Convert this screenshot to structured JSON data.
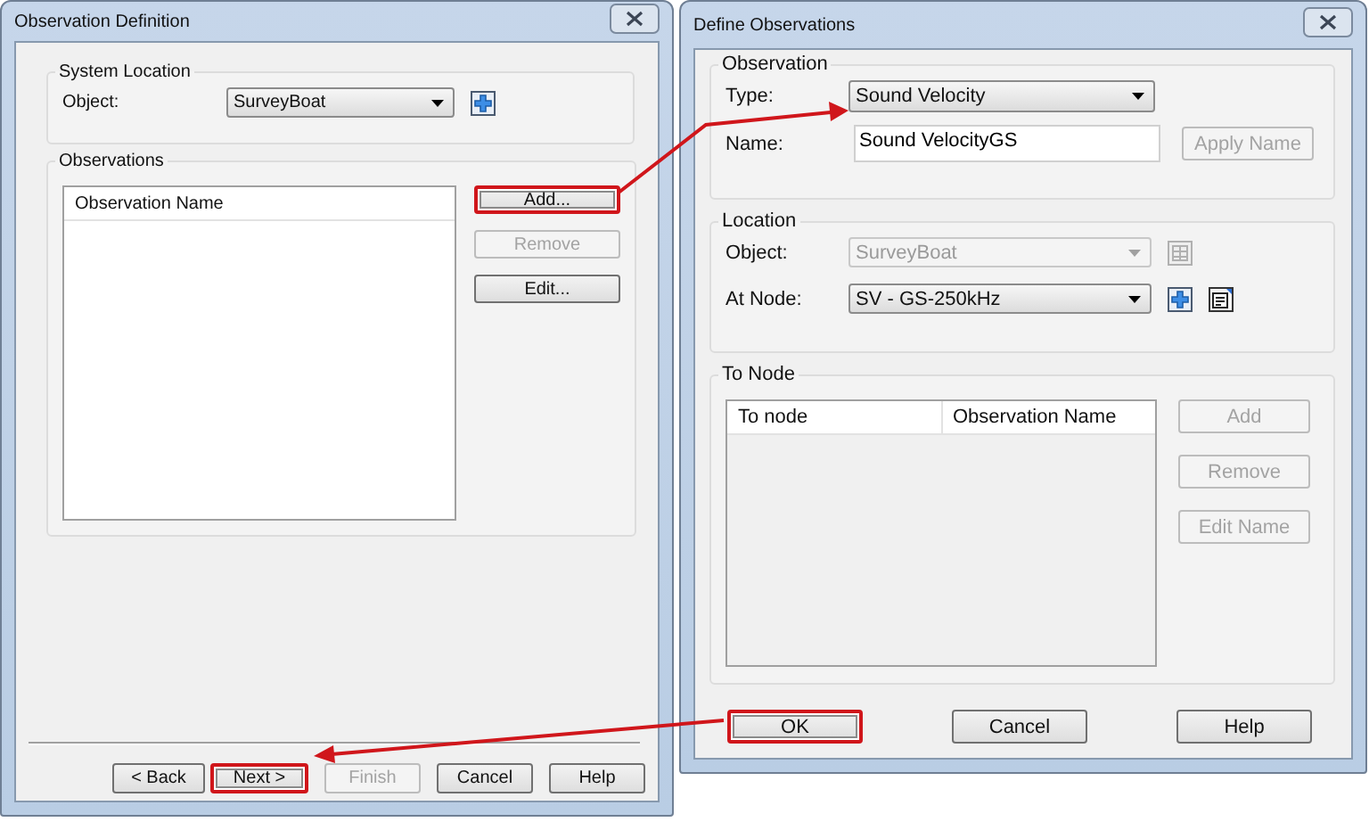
{
  "left_window": {
    "title": "Observation Definition",
    "system_location": {
      "title": "System Location",
      "object_label": "Object:",
      "object_value": "SurveyBoat"
    },
    "observations": {
      "title": "Observations",
      "columns": [
        "Observation Name"
      ],
      "buttons": [
        {
          "label": "Add...",
          "disabled": false,
          "highlighted": true
        },
        {
          "label": "Remove",
          "disabled": true,
          "highlighted": false
        },
        {
          "label": "Edit...",
          "disabled": false,
          "highlighted": false
        }
      ]
    },
    "footer_buttons": [
      {
        "label": "< Back",
        "disabled": false,
        "highlighted": false
      },
      {
        "label": "Next >",
        "disabled": false,
        "highlighted": true
      },
      {
        "label": "Finish",
        "disabled": true,
        "highlighted": false
      },
      {
        "label": "Cancel",
        "disabled": false,
        "highlighted": false
      },
      {
        "label": "Help",
        "disabled": false,
        "highlighted": false
      }
    ]
  },
  "right_window": {
    "title": "Define Observations",
    "observation": {
      "title": "Observation",
      "type_label": "Type:",
      "type_value": "Sound Velocity",
      "name_label": "Name:",
      "name_value": "Sound VelocityGS",
      "apply_button": {
        "label": "Apply Name",
        "disabled": true,
        "highlighted": false
      }
    },
    "location": {
      "title": "Location",
      "object_label": "Object:",
      "object_value": "SurveyBoat",
      "object_disabled": true,
      "node_label": "At Node:",
      "node_value": "SV - GS-250kHz"
    },
    "to_node": {
      "title": "To Node",
      "columns": [
        "To node",
        "Observation Name"
      ],
      "buttons": [
        {
          "label": "Add",
          "disabled": true,
          "highlighted": false
        },
        {
          "label": "Remove",
          "disabled": true,
          "highlighted": false
        },
        {
          "label": "Edit Name",
          "disabled": true,
          "highlighted": false
        }
      ]
    },
    "buttons": [
      {
        "label": "OK",
        "disabled": false,
        "highlighted": true
      },
      {
        "label": "Cancel",
        "disabled": false,
        "highlighted": false
      },
      {
        "label": "Help",
        "disabled": false,
        "highlighted": false
      }
    ]
  }
}
